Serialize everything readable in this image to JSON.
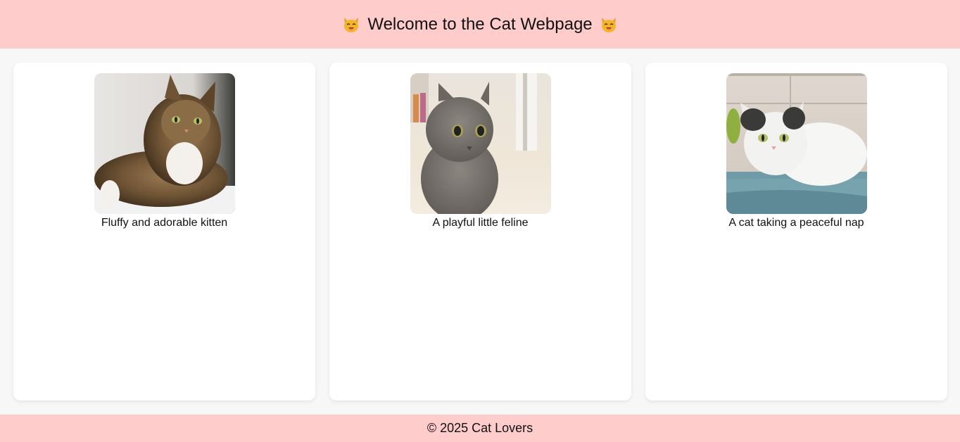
{
  "header": {
    "title": "Welcome to the Cat Webpage",
    "left_icon": "cat-face-icon",
    "right_icon": "cat-face-icon"
  },
  "colors": {
    "header_bg": "#ffcccc",
    "footer_bg": "#ffcccc",
    "page_bg": "#f7f7f7",
    "card_bg": "#ffffff"
  },
  "cards": [
    {
      "caption": "Fluffy and adorable kitten",
      "image": "maine-coon-cat-photo"
    },
    {
      "caption": "A playful little feline",
      "image": "gray-cat-photo"
    },
    {
      "caption": "A cat taking a peaceful nap",
      "image": "white-cat-photo"
    }
  ],
  "footer": {
    "text": "© 2025 Cat Lovers"
  }
}
